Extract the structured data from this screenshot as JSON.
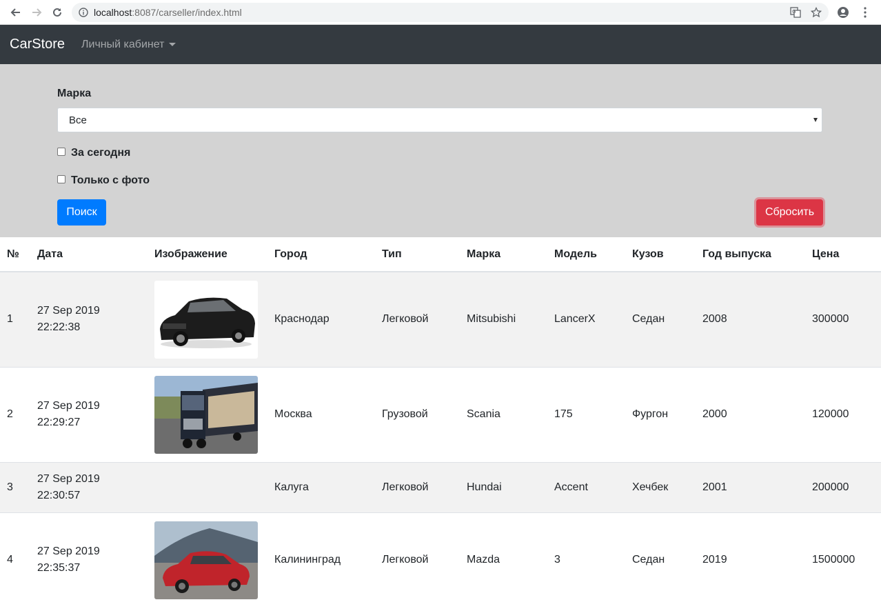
{
  "browser": {
    "url_host": "localhost",
    "url_rest": ":8087/carseller/index.html"
  },
  "navbar": {
    "brand": "CarStore",
    "account_menu": "Личный кабинет"
  },
  "filter": {
    "brand_label": "Марка",
    "brand_selected": "Все",
    "today_label": "За сегодня",
    "photo_label": "Только с фото",
    "search_button": "Поиск",
    "reset_button": "Сбросить"
  },
  "table": {
    "headers": [
      "№",
      "Дата",
      "Изображение",
      "Город",
      "Тип",
      "Марка",
      "Модель",
      "Кузов",
      "Год выпуска",
      "Цена"
    ],
    "rows": [
      {
        "num": "1",
        "date": "27 Sep 2019",
        "time": "22:22:38",
        "image": "black-sedan",
        "city": "Краснодар",
        "type": "Легковой",
        "brand": "Mitsubishi",
        "model": "LancerX",
        "body": "Седан",
        "year": "2008",
        "price": "300000"
      },
      {
        "num": "2",
        "date": "27 Sep 2019",
        "time": "22:29:27",
        "image": "truck",
        "city": "Москва",
        "type": "Грузовой",
        "brand": "Scania",
        "model": "175",
        "body": "Фургон",
        "year": "2000",
        "price": "120000"
      },
      {
        "num": "3",
        "date": "27 Sep 2019",
        "time": "22:30:57",
        "image": "",
        "city": "Калуга",
        "type": "Легковой",
        "brand": "Hundai",
        "model": "Accent",
        "body": "Хечбек",
        "year": "2001",
        "price": "200000"
      },
      {
        "num": "4",
        "date": "27 Sep 2019",
        "time": "22:35:37",
        "image": "red-hatchback",
        "city": "Калининград",
        "type": "Легковой",
        "brand": "Mazda",
        "model": "3",
        "body": "Седан",
        "year": "2019",
        "price": "1500000"
      }
    ]
  }
}
